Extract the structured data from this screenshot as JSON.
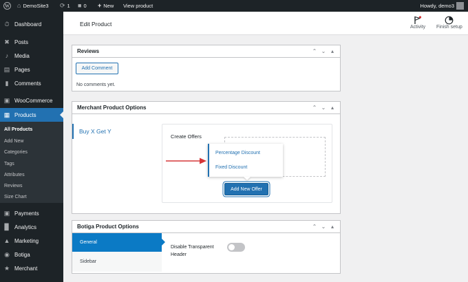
{
  "admin_bar": {
    "site_name": "DemoSite3",
    "updates_count": "1",
    "comments_count": "0",
    "new_label": "New",
    "view_product_label": "View product",
    "howdy": "Howdy, demo3"
  },
  "sidebar": {
    "items": [
      {
        "label": "Dashboard",
        "icon": "dashboard-icon"
      },
      {
        "label": "Posts",
        "icon": "pin-icon"
      },
      {
        "label": "Media",
        "icon": "media-icon"
      },
      {
        "label": "Pages",
        "icon": "pages-icon"
      },
      {
        "label": "Comments",
        "icon": "comments-icon"
      },
      {
        "label": "WooCommerce",
        "icon": "woocommerce-icon"
      },
      {
        "label": "Products",
        "icon": "products-icon"
      },
      {
        "label": "Payments",
        "icon": "payments-icon"
      },
      {
        "label": "Analytics",
        "icon": "analytics-icon"
      },
      {
        "label": "Marketing",
        "icon": "marketing-icon"
      },
      {
        "label": "Botiga",
        "icon": "botiga-icon"
      },
      {
        "label": "Merchant",
        "icon": "merchant-icon"
      }
    ],
    "submenu": [
      "All Products",
      "Add New",
      "Categories",
      "Tags",
      "Attributes",
      "Reviews",
      "Size Chart"
    ]
  },
  "header": {
    "title": "Edit Product",
    "activity_label": "Activity",
    "finish_setup_label": "Finish setup"
  },
  "reviews_box": {
    "title": "Reviews",
    "add_comment_label": "Add Comment",
    "empty_text": "No comments yet."
  },
  "merchant_box": {
    "title": "Merchant Product Options",
    "tab_label": "Buy X Get Y",
    "create_offers_label": "Create Offers",
    "dropdown_options": [
      "Percentage Discount",
      "Fixed Discount"
    ],
    "add_offer_label": "Add New Offer"
  },
  "botiga_box": {
    "title": "Botiga Product Options",
    "tabs": [
      "General",
      "Sidebar"
    ],
    "setting_label_line1": "Disable Transparent",
    "setting_label_line2": "Header",
    "toggle_on": false
  },
  "colors": {
    "admin_dark": "#1d2327",
    "wp_blue": "#2271b1",
    "botiga_tab_blue": "#0b7ac5",
    "annotation_red": "#d63638"
  }
}
